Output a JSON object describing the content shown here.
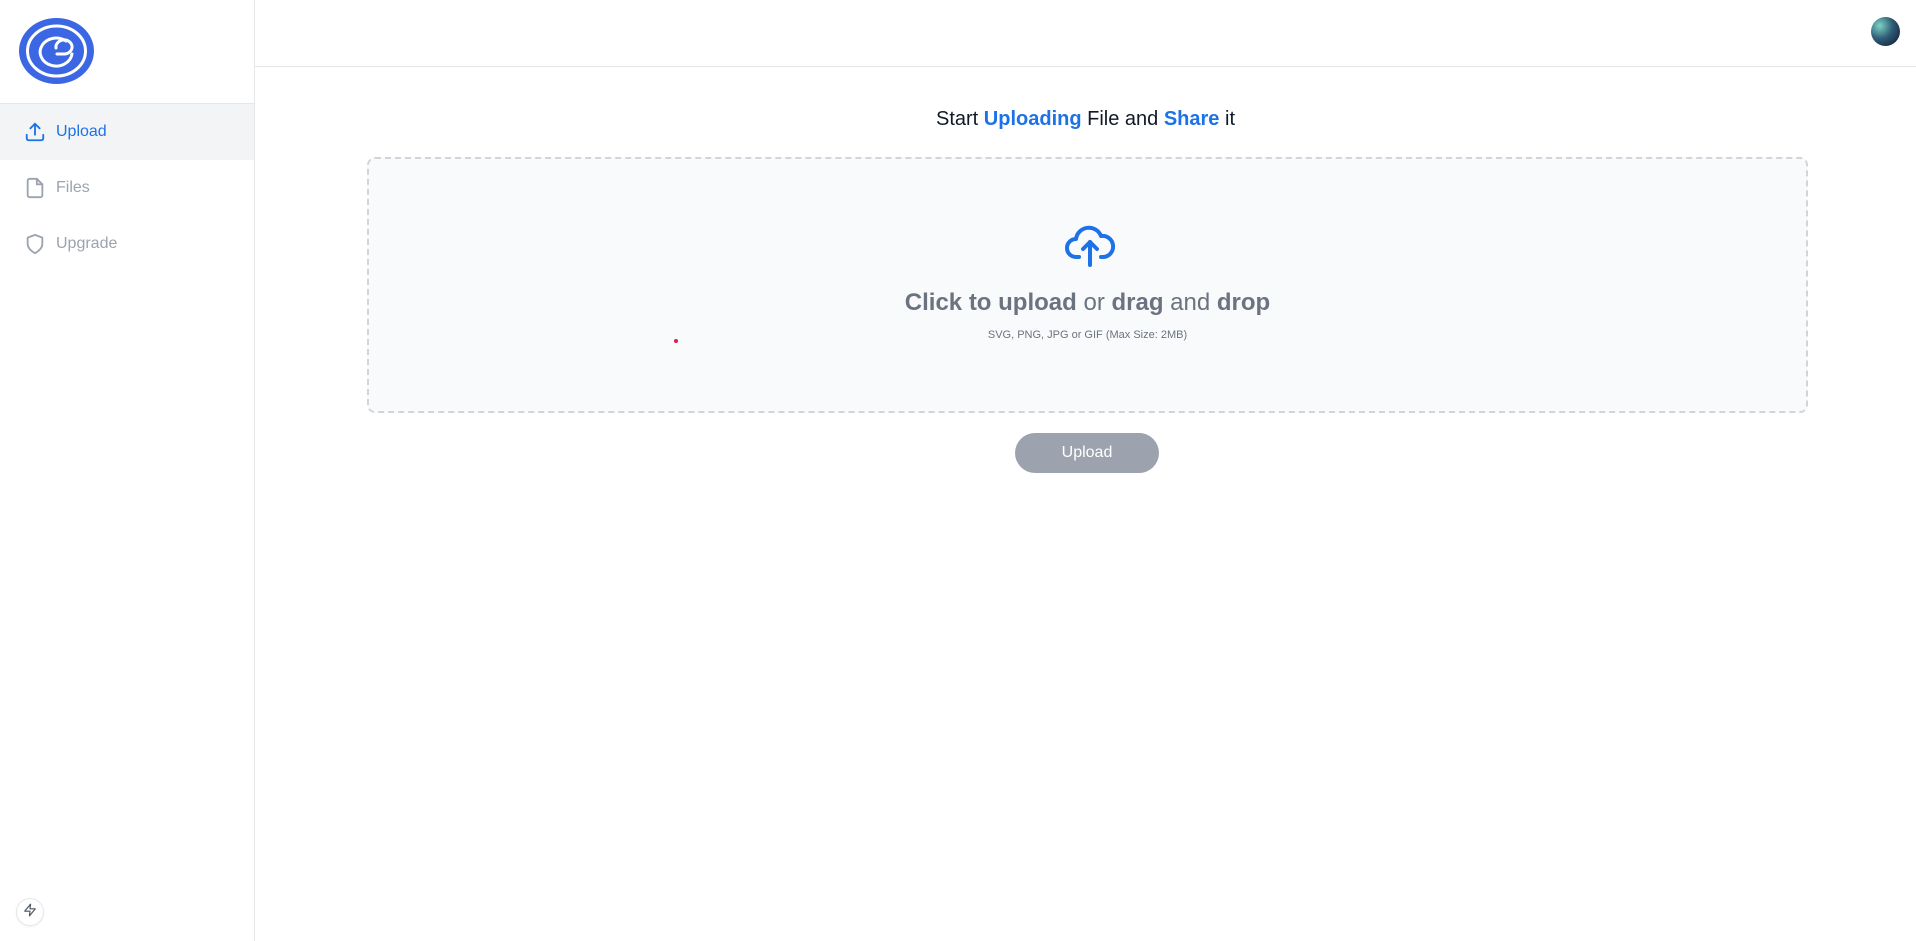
{
  "sidebar": {
    "items": [
      {
        "label": "Upload",
        "icon": "upload-icon",
        "active": true
      },
      {
        "label": "Files",
        "icon": "file-icon",
        "active": false
      },
      {
        "label": "Upgrade",
        "icon": "shield-icon",
        "active": false
      }
    ]
  },
  "heading": {
    "start": "Start",
    "uploading": "Uploading",
    "file_and": "File and",
    "share": "Share",
    "it": "it"
  },
  "dropzone": {
    "click_to_upload": "Click to upload",
    "or": "or",
    "drag": "drag",
    "and": "and",
    "drop": "drop",
    "hint": "SVG, PNG, JPG or GIF (Max Size: 2MB)"
  },
  "upload_button": "Upload",
  "colors": {
    "accent": "#1d72e8",
    "brand": "#3b67e4",
    "button_disabled": "#9ca3af",
    "muted_text": "#6b7280"
  }
}
